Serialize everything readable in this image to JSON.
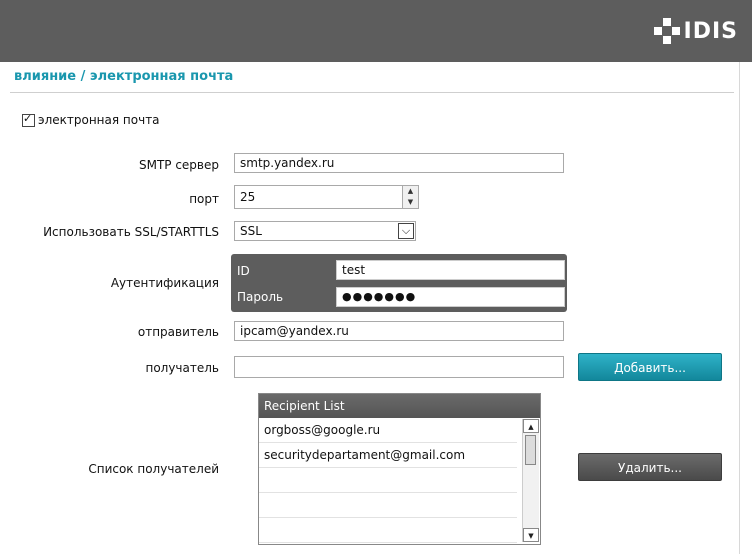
{
  "header": {
    "logo_text": "IDIS"
  },
  "page": {
    "title": "влияние / электронная почта"
  },
  "email_enable": {
    "label": "электронная почта",
    "checked": true
  },
  "smtp": {
    "label": "SMTP сервер",
    "value": "smtp.yandex.ru"
  },
  "port": {
    "label": "порт",
    "value": "25"
  },
  "ssl": {
    "label": "Использовать SSL/STARTTLS",
    "selected": "SSL"
  },
  "auth": {
    "label": "Аутентификация",
    "id_label": "ID",
    "id_value": "test",
    "password_label": "Пароль",
    "password_value": "●●●●●●●"
  },
  "sender": {
    "label": "отправитель",
    "value": "ipcam@yandex.ru"
  },
  "recipient": {
    "label": "получатель",
    "value": "",
    "add_button": "Добавить..."
  },
  "recipients_list": {
    "label": "Список получателей",
    "header": "Recipient List",
    "items": [
      "orgboss@google.ru",
      "securitydepartament@gmail.com",
      "",
      "",
      ""
    ],
    "delete_button": "Удалить..."
  },
  "colors": {
    "accent": "#1a97ae",
    "header_bg": "#5d5d5d"
  }
}
